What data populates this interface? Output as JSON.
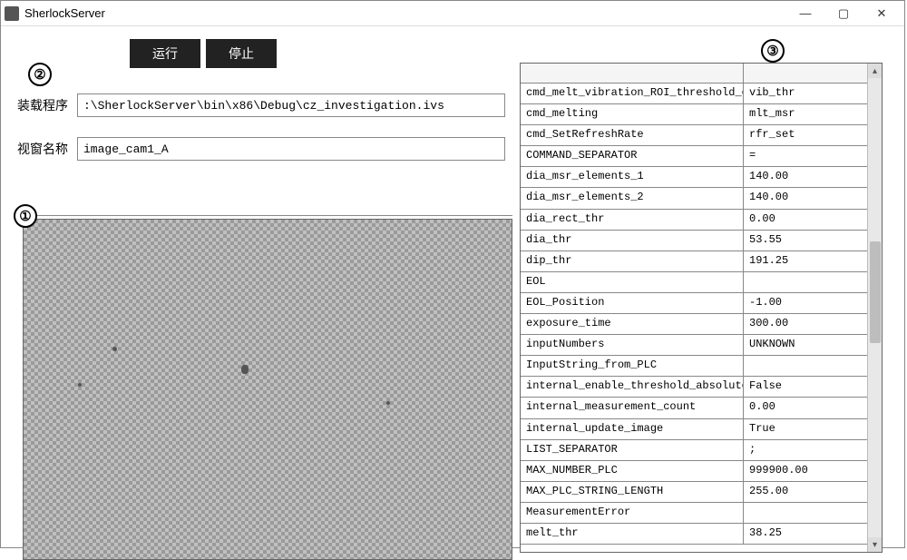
{
  "titlebar": {
    "title": "SherlockServer"
  },
  "badges": {
    "b1": "①",
    "b2": "②",
    "b3": "③"
  },
  "buttons": {
    "run": "运行",
    "stop": "停止"
  },
  "labels": {
    "load_program": "装载程序",
    "window_name": "视窗名称"
  },
  "inputs": {
    "program_path": ":\\SherlockServer\\bin\\x86\\Debug\\cz_investigation.ivs",
    "window_name": "image_cam1_A"
  },
  "params": [
    {
      "key": "cmd_melt_vibration_ROI_threshold_change",
      "value": "vib_thr"
    },
    {
      "key": "cmd_melting",
      "value": "mlt_msr"
    },
    {
      "key": "cmd_SetRefreshRate",
      "value": "rfr_set"
    },
    {
      "key": "COMMAND_SEPARATOR",
      "value": "="
    },
    {
      "key": "dia_msr_elements_1",
      "value": "140.00"
    },
    {
      "key": "dia_msr_elements_2",
      "value": "140.00"
    },
    {
      "key": "dia_rect_thr",
      "value": "0.00"
    },
    {
      "key": "dia_thr",
      "value": "53.55"
    },
    {
      "key": "dip_thr",
      "value": "191.25"
    },
    {
      "key": "EOL",
      "value": ""
    },
    {
      "key": "EOL_Position",
      "value": "-1.00"
    },
    {
      "key": "exposure_time",
      "value": "300.00"
    },
    {
      "key": "inputNumbers",
      "value": "UNKNOWN"
    },
    {
      "key": "InputString_from_PLC",
      "value": ""
    },
    {
      "key": "internal_enable_threshold_absolute",
      "value": "False"
    },
    {
      "key": "internal_measurement_count",
      "value": "0.00"
    },
    {
      "key": "internal_update_image",
      "value": "True"
    },
    {
      "key": "LIST_SEPARATOR",
      "value": ";"
    },
    {
      "key": "MAX_NUMBER_PLC",
      "value": "999900.00"
    },
    {
      "key": "MAX_PLC_STRING_LENGTH",
      "value": "255.00"
    },
    {
      "key": "MeasurementError",
      "value": ""
    },
    {
      "key": "melt_thr",
      "value": "38.25"
    }
  ]
}
